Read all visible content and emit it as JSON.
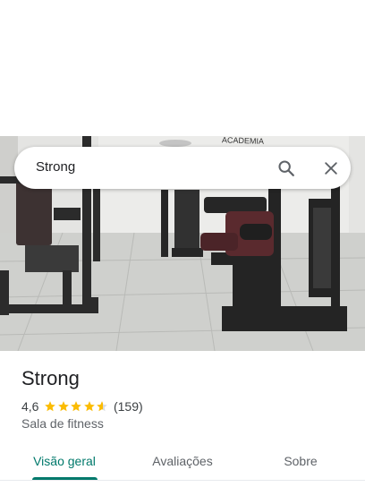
{
  "search": {
    "query": "Strong"
  },
  "icons": {
    "search": "search-icon",
    "close": "close-icon",
    "star": "star-icon"
  },
  "place": {
    "name": "Strong",
    "rating": "4,6",
    "rating_value": 4.6,
    "reviews": "(159)",
    "category": "Sala de fitness",
    "photo_sign": "ACADEMIA"
  },
  "tabs": [
    {
      "label": "Visão geral",
      "active": true
    },
    {
      "label": "Avaliações",
      "active": false
    },
    {
      "label": "Sobre",
      "active": false
    }
  ],
  "colors": {
    "accent": "#00796b",
    "star": "#fbbc04",
    "text": "#202124",
    "secondary": "#5f6368"
  }
}
